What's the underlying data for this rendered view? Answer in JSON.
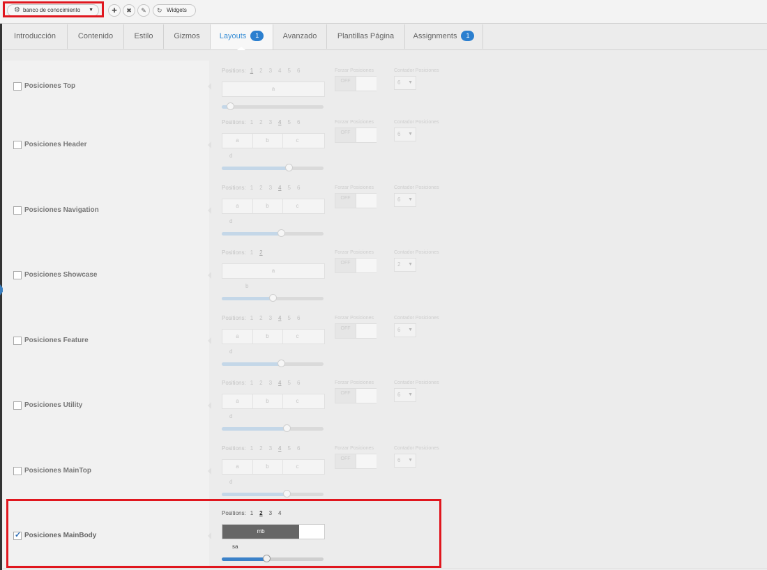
{
  "toolbar": {
    "preset_label": "banco de conocimiento",
    "widgets_label": "Widgets"
  },
  "tabs": [
    {
      "label": "Introducción"
    },
    {
      "label": "Contenido"
    },
    {
      "label": "Estilo"
    },
    {
      "label": "Gizmos"
    },
    {
      "label": "Layouts",
      "badge": "1"
    },
    {
      "label": "Avanzado"
    },
    {
      "label": "Plantillas Página"
    },
    {
      "label": "Assignments",
      "badge": "1"
    }
  ],
  "common": {
    "positions_label": "Positions:",
    "force_label": "Forzar Posiciones",
    "count_label": "Contador Posiciones",
    "off_label": "OFF"
  },
  "rows": [
    {
      "label": "Posiciones Top",
      "nums": [
        "1",
        "2",
        "3",
        "4",
        "5",
        "6"
      ],
      "selected": "1",
      "cells": [
        "a"
      ],
      "extra": [],
      "count": "6",
      "checked": false,
      "slider": 0.08
    },
    {
      "label": "Posiciones Header",
      "nums": [
        "1",
        "2",
        "3",
        "4",
        "5",
        "6"
      ],
      "selected": "4",
      "cells": [
        "a",
        "b",
        "c"
      ],
      "extra": [
        "d"
      ],
      "count": "6",
      "checked": false,
      "slider": 0.66
    },
    {
      "label": "Posiciones Navigation",
      "nums": [
        "1",
        "2",
        "3",
        "4",
        "5",
        "6"
      ],
      "selected": "4",
      "cells": [
        "a",
        "b",
        "c"
      ],
      "extra": [
        "d"
      ],
      "count": "6",
      "checked": false,
      "slider": 0.58
    },
    {
      "label": "Posiciones Showcase",
      "nums": [
        "1",
        "2"
      ],
      "selected": "2",
      "cells": [
        "a"
      ],
      "extra": [
        "b"
      ],
      "count": "2",
      "checked": false,
      "slider": 0.5
    },
    {
      "label": "Posiciones Feature",
      "nums": [
        "1",
        "2",
        "3",
        "4",
        "5",
        "6"
      ],
      "selected": "4",
      "cells": [
        "a",
        "b",
        "c"
      ],
      "extra": [
        "d"
      ],
      "count": "6",
      "checked": false,
      "slider": 0.58
    },
    {
      "label": "Posiciones Utility",
      "nums": [
        "1",
        "2",
        "3",
        "4",
        "5",
        "6"
      ],
      "selected": "4",
      "cells": [
        "a",
        "b",
        "c"
      ],
      "extra": [
        "d"
      ],
      "count": "6",
      "checked": false,
      "slider": 0.64
    },
    {
      "label": "Posiciones MainTop",
      "nums": [
        "1",
        "2",
        "3",
        "4",
        "5",
        "6"
      ],
      "selected": "4",
      "cells": [
        "a",
        "b",
        "c"
      ],
      "extra": [
        "d"
      ],
      "count": "6",
      "checked": false,
      "slider": 0.64
    },
    {
      "label": "Posiciones MainBody",
      "nums": [
        "1",
        "2",
        "3",
        "4"
      ],
      "selected": "2",
      "cells": [
        "mb"
      ],
      "extra": [
        "sa"
      ],
      "count": "",
      "checked": true,
      "slider": 0.44
    }
  ],
  "colors": {
    "accent": "#2b7fcf",
    "highlight": "#e0161e"
  }
}
